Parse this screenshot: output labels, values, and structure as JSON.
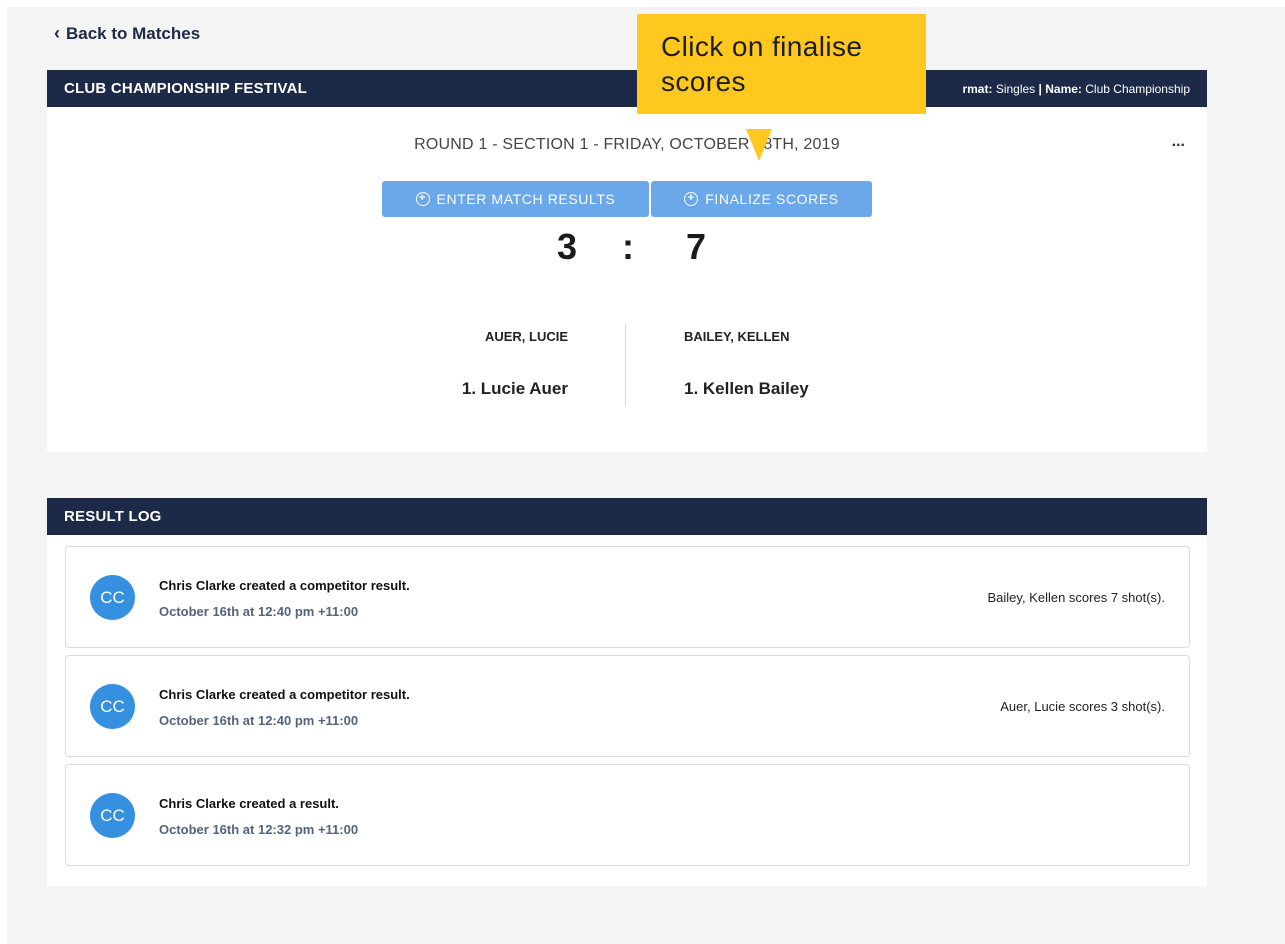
{
  "nav": {
    "back_label": "Back to Matches"
  },
  "match": {
    "header_title": "CLUB CHAMPIONSHIP FESTIVAL",
    "meta_format_label": "rmat:",
    "meta_format_value": "Singles",
    "meta_separator": "|",
    "meta_name_label": "Name:",
    "meta_name_value": "Club Championship",
    "round_title": "ROUND 1 - SECTION 1 - FRIDAY, OCTOBER 18TH, 2019",
    "more_label": "...",
    "enter_button_label": "ENTER MATCH RESULTS",
    "finalize_button_label": "FINALIZE SCORES",
    "button_icon": "plus-circle-icon",
    "score_home": "3",
    "score_separator": ":",
    "score_away": "7",
    "team_home": "AUER, LUCIE",
    "team_away": "BAILEY, KELLEN",
    "player_home": "1. Lucie Auer",
    "player_away": "1. Kellen Bailey"
  },
  "result_log": {
    "header_title": "RESULT LOG",
    "entries": [
      {
        "initials": "CC",
        "title": "Chris Clarke created a competitor result.",
        "time": "October 16th at 12:40 pm +11:00",
        "detail": "Bailey, Kellen scores 7 shot(s)."
      },
      {
        "initials": "CC",
        "title": "Chris Clarke created a competitor result.",
        "time": "October 16th at 12:40 pm +11:00",
        "detail": "Auer, Lucie scores 3 shot(s)."
      },
      {
        "initials": "CC",
        "title": "Chris Clarke created a result.",
        "time": "October 16th at 12:32 pm +11:00",
        "detail": ""
      }
    ]
  },
  "tooltip": {
    "text": "Click on finalise scores"
  },
  "colors": {
    "header_bg": "#1c2a47",
    "button_bg": "#6aa8ea",
    "avatar_bg": "#3590e0",
    "tooltip_bg": "#ffc81f",
    "page_bg": "#f4f4f4"
  }
}
